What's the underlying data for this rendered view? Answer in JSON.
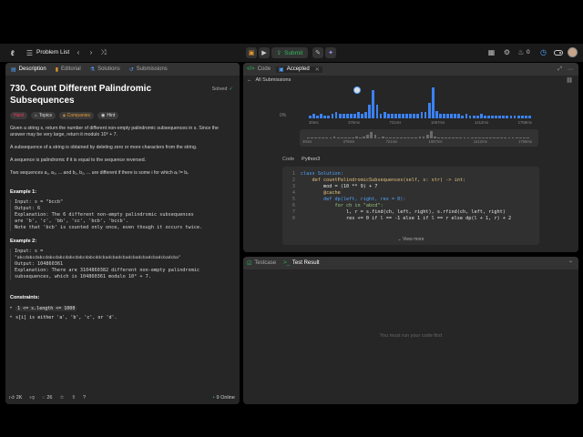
{
  "topbar": {
    "problem_list": "Problem List",
    "submit_label": "Submit",
    "streak_count": "0"
  },
  "left": {
    "tabs": [
      "Description",
      "Editorial",
      "Solutions",
      "Submissions"
    ],
    "title": "730. Count Different Palindromic Subsequences",
    "solved": "Solved",
    "tags": {
      "difficulty": "Hard",
      "topics": "Topics",
      "companies": "Companies",
      "hint": "Hint"
    },
    "desc_p1": "Given a string s, return the number of different non-empty palindromic subsequences in s. Since the answer may be very large, return it modulo 10⁹ + 7.",
    "desc_p2": "A subsequence of a string is obtained by deleting zero or more characters from the string.",
    "desc_p3": "A sequence is palindromic if it is equal to the sequence reversed.",
    "desc_p4": "Two sequences a₁, a₂, ... and b₁, b₂, ... are different if there is some i for which aᵢ != bᵢ.",
    "ex1_title": "Example 1:",
    "ex1_lines": [
      "Input: s = \"bccb\"",
      "Output: 6",
      "Explanation: The 6 different non-empty palindromic subsequences",
      "are 'b', 'c', 'bb', 'cc', 'bcb', 'bccb'.",
      "Note that 'bcb' is counted only once, even though it occurs twice."
    ],
    "ex2_title": "Example 2:",
    "ex2_lines": [
      "Input: s =",
      "\"abcdabcdabcdabcdabcdabcdabcdabcddcbadcbadcbadcbadcbadcbadcbadcba\"",
      "Output: 104860361",
      "Explanation: There are 3104860382 different non-empty palindromic",
      "subsequences, which is 104860361 modulo 10⁹ + 7."
    ],
    "constraints_title": "Constraints:",
    "constraint1": "1 <= s.length <= 1000",
    "constraint2": "s[i] is either 'a', 'b', 'c', or 'd'.",
    "likes": "2K",
    "comments": "26",
    "online": "9 Online"
  },
  "code_panel": {
    "tab_code": "Code",
    "tab_accepted": "Accepted",
    "all_submissions": "All Submissions",
    "zero_pct": "0%",
    "xlabels_top": [
      "30ms",
      "375ms",
      "721ms",
      "1067ms",
      "1412ms",
      "1758ms"
    ],
    "xlabels_bottom": [
      "30ms",
      "375ms",
      "721ms",
      "1067ms",
      "1412ms",
      "1758ms"
    ],
    "code_label": "Code",
    "lang": "Python3",
    "view_more": "View more",
    "lines": [
      {
        "n": "1",
        "t": "class Solution:"
      },
      {
        "n": "2",
        "t": "    def countPalindromicSubsequences(self, s: str) -> int:"
      },
      {
        "n": "3",
        "t": "        mod = (10 ** 9) + 7"
      },
      {
        "n": "4",
        "t": "        @cache"
      },
      {
        "n": "5",
        "t": "        def dp(left, right, res = 0):"
      },
      {
        "n": "6",
        "t": "            for ch in \"abcd\":"
      },
      {
        "n": "7",
        "t": "                l, r = s.find(ch, left, right), s.rfind(ch, left, right)"
      },
      {
        "n": "8",
        "t": "                res += 0 if l == -1 else 1 if l == r else dp(l + 1, r) + 2"
      }
    ]
  },
  "test_panel": {
    "tab_testcase": "Testcase",
    "tab_result": "Test Result",
    "empty_msg": "You must run your code first"
  },
  "chart_data": {
    "type": "bar",
    "xlabel": "",
    "ylabel": "",
    "x_ticks": [
      "30ms",
      "375ms",
      "721ms",
      "1067ms",
      "1412ms",
      "1758ms"
    ],
    "values": [
      2,
      3,
      2,
      3,
      2,
      2,
      3,
      4,
      3,
      3,
      3,
      3,
      3,
      4,
      3,
      4,
      9,
      18,
      9,
      3,
      4,
      3,
      3,
      3,
      3,
      3,
      3,
      3,
      3,
      3,
      4,
      4,
      10,
      20,
      5,
      3,
      3,
      3,
      3,
      3,
      3,
      2,
      3,
      2,
      2,
      2,
      3,
      2,
      2,
      2,
      2,
      2,
      2,
      2,
      2,
      2,
      2,
      2,
      2,
      2
    ]
  }
}
